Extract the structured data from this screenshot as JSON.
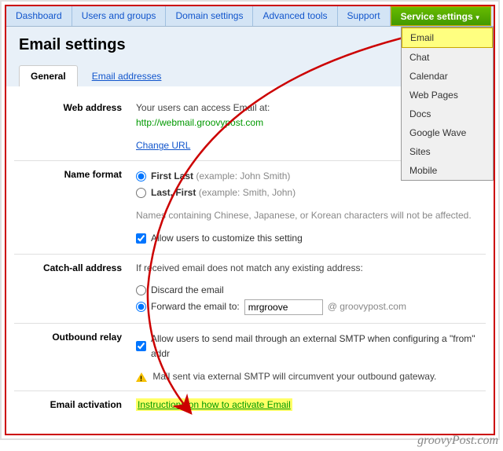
{
  "nav": {
    "items": [
      "Dashboard",
      "Users and groups",
      "Domain settings",
      "Advanced tools",
      "Support"
    ],
    "active": "Service settings"
  },
  "dropdown": {
    "items": [
      "Email",
      "Chat",
      "Calendar",
      "Web Pages",
      "Docs",
      "Google Wave",
      "Sites",
      "Mobile"
    ]
  },
  "page": {
    "title": "Email settings"
  },
  "tabs": {
    "active": "General",
    "other": "Email addresses"
  },
  "web_address": {
    "label": "Web address",
    "intro": "Your users can access Email at:",
    "url": "http://webmail.groovypost.com",
    "change": "Change URL"
  },
  "name_format": {
    "label": "Name format",
    "opt1": "First Last",
    "opt1_ex": "(example: John Smith)",
    "opt2": "Last, First",
    "opt2_ex": "(example: Smith, John)",
    "note": "Names containing Chinese, Japanese, or Korean characters will not be affected.",
    "allow": "Allow users to customize this setting"
  },
  "catch_all": {
    "label": "Catch-all address",
    "intro": "If received email does not match any existing address:",
    "opt1": "Discard the email",
    "opt2": "Forward the email to:",
    "value": "mrgroove",
    "domain": "@ groovypost.com"
  },
  "outbound": {
    "label": "Outbound relay",
    "allow": "Allow users to send mail through an external SMTP when configuring a \"from\" addr",
    "warn": "Mail sent via external SMTP will circumvent your outbound gateway."
  },
  "activation": {
    "label": "Email activation",
    "link": "Instructions on how to activate Email"
  },
  "watermark": "groovyPost.com"
}
